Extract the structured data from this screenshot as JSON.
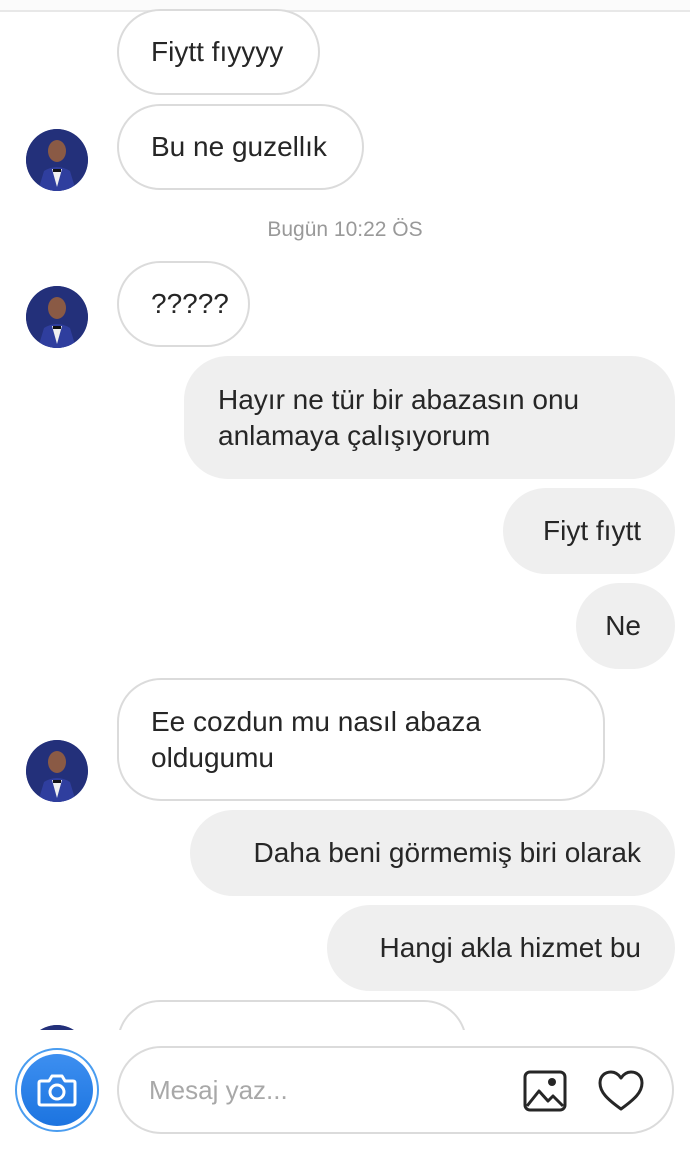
{
  "thread": {
    "timestamp": "Bugün 10:22 ÖS",
    "messages": [
      {
        "side": "in",
        "text": "Fiytt fıyyyy"
      },
      {
        "side": "in",
        "text": "Bu ne guzellık"
      },
      {
        "side": "in",
        "text": "?????"
      },
      {
        "side": "out",
        "text": "Hayır ne tür bir abazasın onu anlamaya çalışıyorum"
      },
      {
        "side": "out",
        "text": "Fiyt fıytt"
      },
      {
        "side": "out",
        "text": "Ne"
      },
      {
        "side": "in",
        "text": "Ee cozdun mu nasıl abaza oldugumu"
      },
      {
        "side": "out",
        "text": "Daha beni görmemiş biri olarak"
      },
      {
        "side": "out",
        "text": "Hangi akla hizmet bu"
      }
    ]
  },
  "composer": {
    "placeholder": "Mesaj yaz...",
    "camera_icon": "camera-icon",
    "gallery_icon": "image-icon",
    "like_icon": "heart-icon"
  },
  "colors": {
    "accent": "#3d8ff0",
    "outgoing_bubble": "#efefef",
    "incoming_border": "#dbdbdb",
    "meta_text": "#999999"
  }
}
